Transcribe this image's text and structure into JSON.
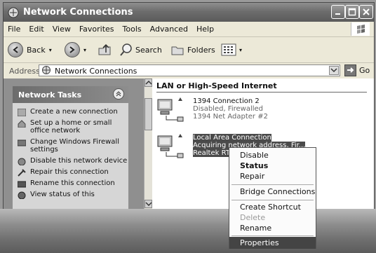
{
  "window": {
    "title": "Network Connections"
  },
  "menu": [
    "File",
    "Edit",
    "View",
    "Favorites",
    "Tools",
    "Advanced",
    "Help"
  ],
  "toolbar": {
    "back": "Back",
    "search": "Search",
    "folders": "Folders"
  },
  "address": {
    "label": "Address",
    "value": "Network Connections",
    "go": "Go"
  },
  "tasks": {
    "title": "Network Tasks",
    "items": [
      "Create a new connection",
      "Set up a home or small office network",
      "Change Windows Firewall settings",
      "Disable this network device",
      "Repair this connection",
      "Rename this connection",
      "View status of this"
    ]
  },
  "content": {
    "group_title": "LAN or High-Speed Internet",
    "connections": [
      {
        "name": "1394 Connection 2",
        "status": "Disabled, Firewalled",
        "device": "1394 Net Adapter #2"
      },
      {
        "name": "Local Area Connection",
        "status": "Acquiring network address, Fir...",
        "device": "Realtek RTL"
      }
    ]
  },
  "context_menu": [
    {
      "label": "Disable",
      "bold": false,
      "disabled": false
    },
    {
      "label": "Status",
      "bold": true,
      "disabled": false
    },
    {
      "label": "Repair",
      "bold": false,
      "disabled": false
    },
    {
      "label": "Bridge Connections",
      "bold": false,
      "disabled": false
    },
    {
      "label": "Create Shortcut",
      "bold": false,
      "disabled": false
    },
    {
      "label": "Delete",
      "bold": false,
      "disabled": true
    },
    {
      "label": "Rename",
      "bold": false,
      "disabled": false
    },
    {
      "label": "Properties",
      "bold": false,
      "disabled": false,
      "highlighted": true
    }
  ]
}
